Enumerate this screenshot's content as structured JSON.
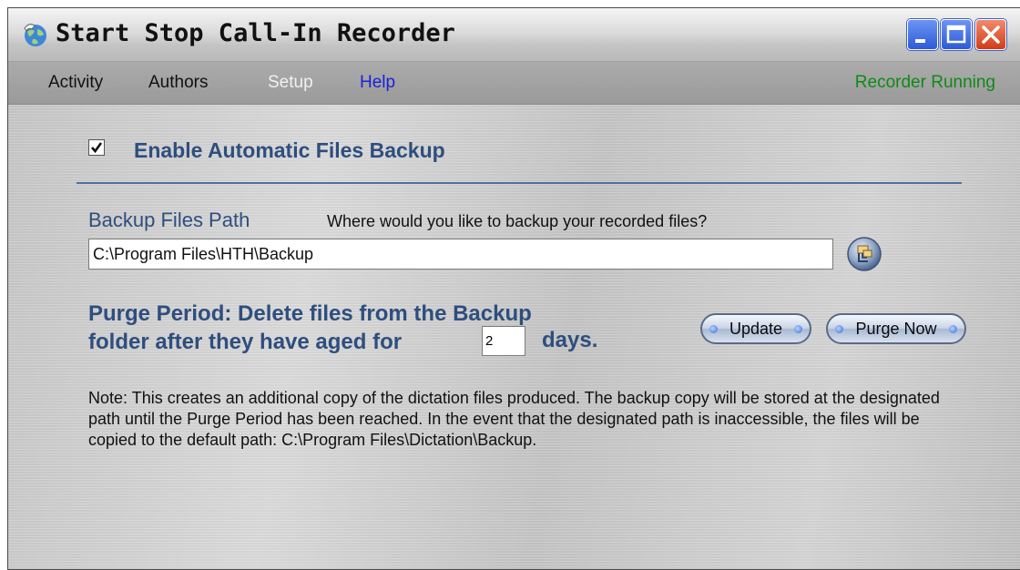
{
  "window": {
    "title": "Start Stop Call-In Recorder",
    "icons": [
      "globe-phone-icon",
      "minimize-icon",
      "maximize-icon",
      "close-icon"
    ]
  },
  "menu": {
    "items": [
      {
        "label": "Activity"
      },
      {
        "label": "Authors"
      },
      {
        "label": "Setup",
        "state": "active"
      },
      {
        "label": "Help"
      }
    ],
    "status": "Recorder Running"
  },
  "backup": {
    "enable_checked": true,
    "enable_label": "Enable Automatic Files Backup",
    "path_heading": "Backup Files Path",
    "path_hint": "Where would you like to backup your recorded files?",
    "path_value": "C:\\Program Files\\HTH\\Backup",
    "browse_icon": "folder-browse-icon",
    "purge_line1": "Purge Period:  Delete files from the Backup",
    "purge_line2": "folder after they have aged for",
    "purge_days": "2",
    "days_label": "days.",
    "update_label": "Update",
    "purge_now_label": "Purge Now",
    "note": "Note: This creates an additional copy of the dictation files produced. The backup copy will be stored at the designated path until the Purge Period has been reached. In the event that the designated path is inaccessible, the files will be copied to the default path: C:\\Program Files\\Dictation\\Backup."
  },
  "colors": {
    "heading": "#2e4e7e",
    "status": "#0f8a16",
    "help_link": "#1a22d8",
    "active_menu": "#f0f0f0"
  }
}
